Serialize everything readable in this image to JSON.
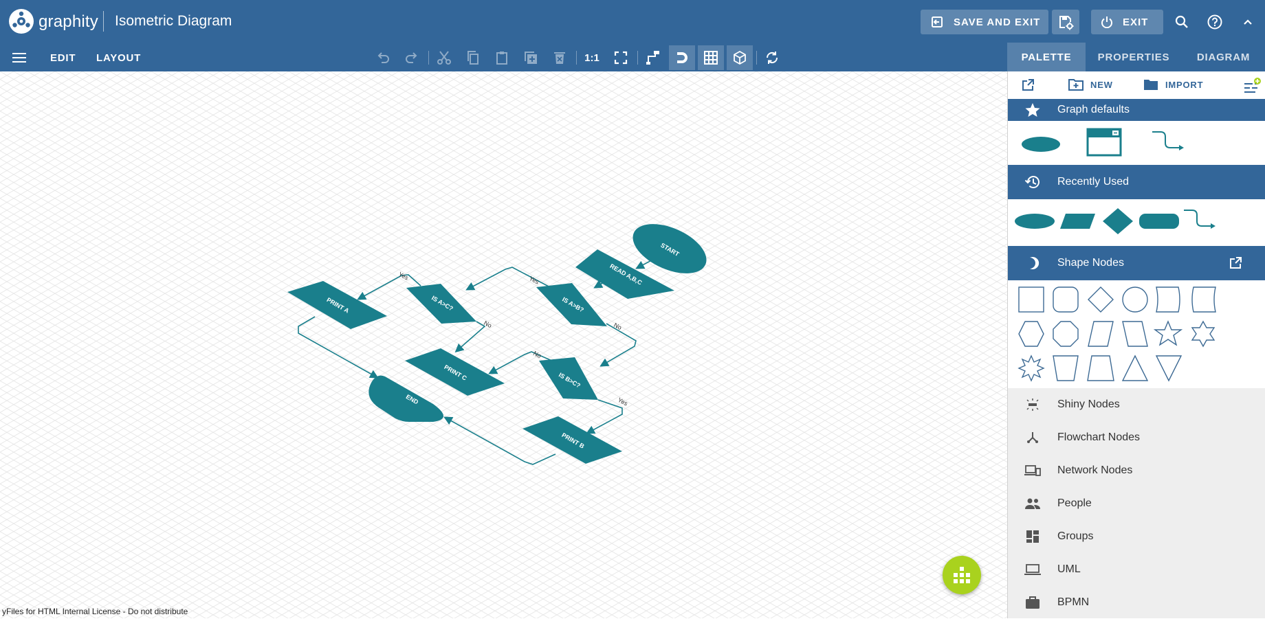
{
  "header": {
    "app_name": "graphity",
    "doc_title": "Isometric Diagram",
    "save_exit_label": "SAVE AND EXIT",
    "exit_label": "EXIT"
  },
  "toolbar": {
    "edit_label": "EDIT",
    "layout_label": "LAYOUT",
    "zoom_label": "1:1"
  },
  "tabs": [
    "PALETTE",
    "PROPERTIES",
    "DIAGRAM"
  ],
  "palette": {
    "new_label": "NEW",
    "import_label": "IMPORT",
    "graph_defaults": "Graph defaults",
    "recently_used": "Recently Used",
    "shape_nodes": "Shape Nodes",
    "categories": [
      "Shiny Nodes",
      "Flowchart Nodes",
      "Network Nodes",
      "People",
      "Groups",
      "UML",
      "BPMN"
    ]
  },
  "diagram": {
    "nodes": {
      "start": "START",
      "read": "READ A,B,C",
      "is_a_b": "IS A>B?",
      "is_a_c": "IS A>C?",
      "print_a": "PRINT A",
      "print_c": "PRINT C",
      "is_b_c": "IS B>C?",
      "end": "END",
      "print_b": "PRINT B"
    },
    "edge_labels": {
      "yes_1": "Yes",
      "yes_2": "Yes",
      "no_1": "No",
      "no_2": "No",
      "no_3": "No",
      "yes_3": "Yes"
    }
  },
  "colors": {
    "brand": "#336699",
    "node": "#1a7f8c",
    "fab": "#a9d21e"
  },
  "license_text": "yFiles for HTML Internal License - Do not distribute"
}
